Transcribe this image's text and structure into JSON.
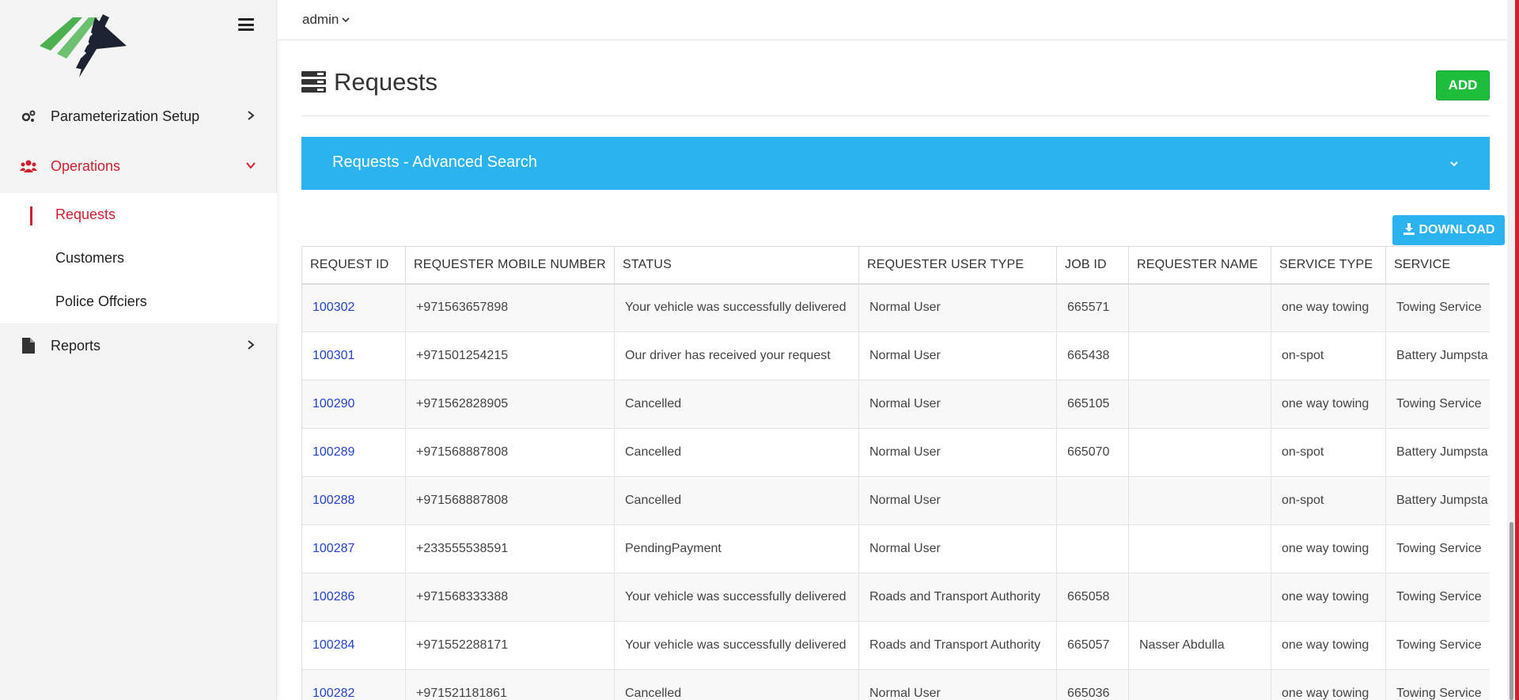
{
  "brand": {
    "logo_icon": "road-logo-icon"
  },
  "sidebar": {
    "menu_icon": "hamburger-icon",
    "items": [
      {
        "label": "Parameterization Setup",
        "icon": "gears-icon",
        "chevron": "chevron-right-icon"
      },
      {
        "label": "Operations",
        "icon": "users-icon",
        "chevron": "chevron-down-icon"
      },
      {
        "label": "Reports",
        "icon": "file-icon",
        "chevron": "chevron-right-icon"
      }
    ],
    "submenu": [
      {
        "label": "Requests"
      },
      {
        "label": "Customers"
      },
      {
        "label": "Police Offciers"
      }
    ]
  },
  "header": {
    "user": "admin"
  },
  "page": {
    "title": "Requests",
    "title_icon": "server-icon",
    "add_label": "ADD",
    "search_panel_title": "Requests - Advanced Search",
    "download_label": "DOWNLOAD",
    "download_icon": "download-icon"
  },
  "table": {
    "columns": [
      "REQUEST ID",
      "REQUESTER MOBILE NUMBER",
      "STATUS",
      "REQUESTER USER TYPE",
      "JOB ID",
      "REQUESTER NAME",
      "SERVICE TYPE",
      "SERVICE"
    ],
    "rows": [
      [
        "100302",
        "+971563657898",
        "Your vehicle was successfully delivered",
        "Normal User",
        "665571",
        "",
        "one way towing",
        "Towing Service"
      ],
      [
        "100301",
        "+971501254215",
        "Our driver has received your request",
        "Normal User",
        "665438",
        "",
        "on-spot",
        "Battery Jumpsta"
      ],
      [
        "100290",
        "+971562828905",
        "Cancelled",
        "Normal User",
        "665105",
        "",
        "one way towing",
        "Towing Service"
      ],
      [
        "100289",
        "+971568887808",
        "Cancelled",
        "Normal User",
        "665070",
        "",
        "on-spot",
        "Battery Jumpsta"
      ],
      [
        "100288",
        "+971568887808",
        "Cancelled",
        "Normal User",
        "",
        "",
        "on-spot",
        "Battery Jumpsta"
      ],
      [
        "100287",
        "+233555538591",
        "PendingPayment",
        "Normal User",
        "",
        "",
        "one way towing",
        "Towing Service"
      ],
      [
        "100286",
        "+971568333388",
        "Your vehicle was successfully delivered",
        "Roads and Transport Authority",
        "665058",
        "",
        "one way towing",
        "Towing Service"
      ],
      [
        "100284",
        "+971552288171",
        "Your vehicle was successfully delivered",
        "Roads and Transport Authority",
        "665057",
        "Nasser Abdulla",
        "one way towing",
        "Towing Service"
      ],
      [
        "100282",
        "+971521181861",
        "Cancelled",
        "Normal User",
        "665036",
        "",
        "one way towing",
        "Towing Service"
      ]
    ]
  },
  "colors": {
    "accent_red": "#d0202f",
    "search_blue": "#2bb3f0",
    "add_green": "#1ebe3c",
    "link_blue": "#2244cc"
  }
}
